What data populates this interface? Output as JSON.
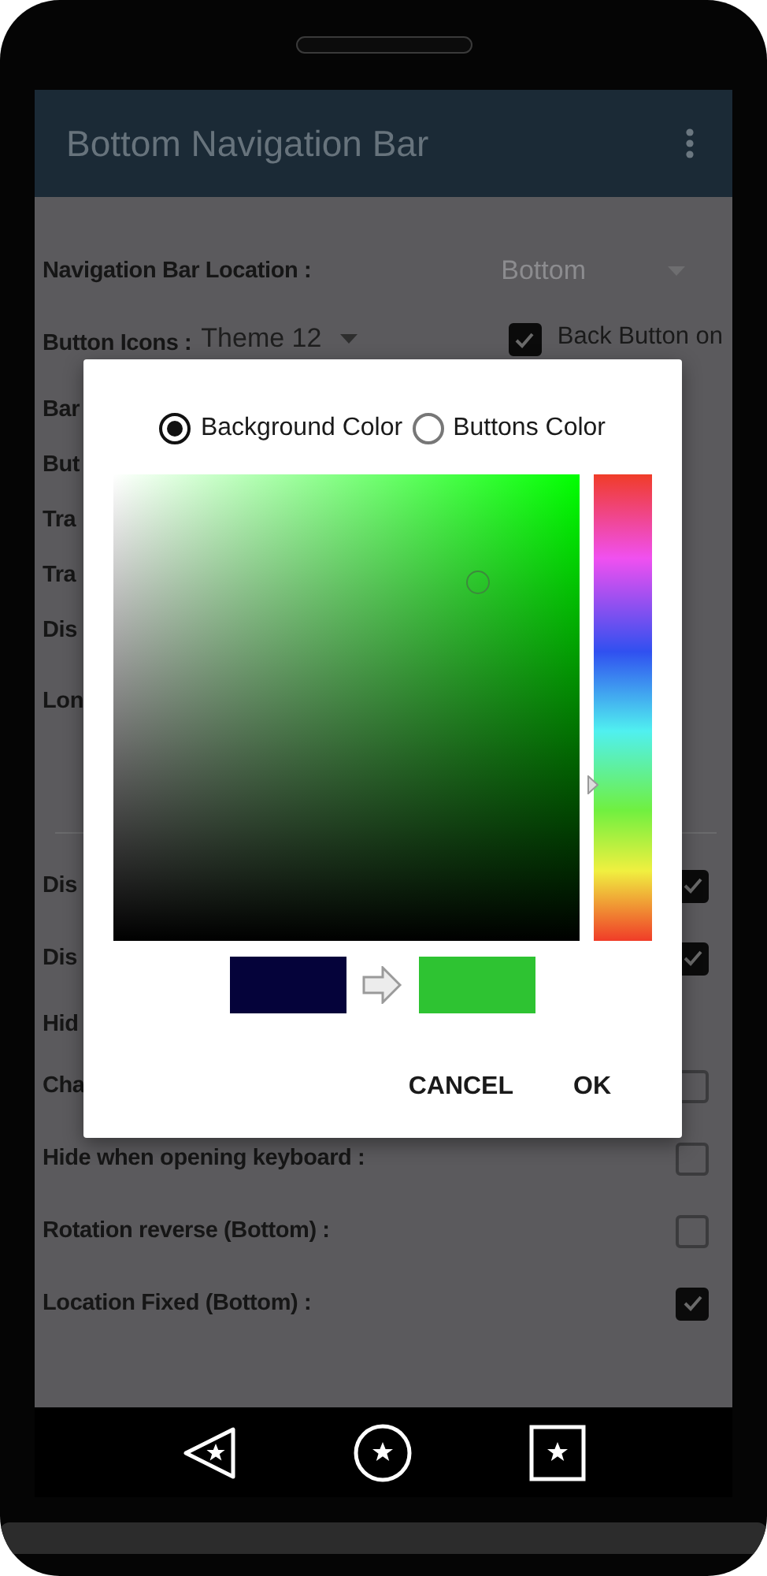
{
  "title": "Bottom Navigation Bar",
  "settings": [
    {
      "kind": "dropdown",
      "label": "Navigation Bar Location :",
      "value": "Bottom",
      "disabled": true
    },
    {
      "kind": "dropdown",
      "label": "Button Icons :",
      "value": "Theme 12",
      "disabled": false,
      "checkbox": {
        "label": "Back Button on",
        "checked": true
      }
    },
    {
      "kind": "label",
      "label": "Bar"
    },
    {
      "kind": "label",
      "label": "But"
    },
    {
      "kind": "label",
      "label": "Tra"
    },
    {
      "kind": "label",
      "label": "Tra"
    },
    {
      "kind": "label",
      "label": "Dis"
    },
    {
      "kind": "section",
      "label": "Lon"
    },
    {
      "kind": "checkbox",
      "label": "Dis",
      "checked": true
    },
    {
      "kind": "checkbox",
      "label": "Dis",
      "checked": true
    },
    {
      "kind": "label",
      "label": "Hid"
    },
    {
      "kind": "checkbox",
      "label": "Cha",
      "checked": false
    },
    {
      "kind": "checkbox",
      "label": "Hide when opening keyboard :",
      "checked": false
    },
    {
      "kind": "checkbox",
      "label": "Rotation reverse (Bottom) :",
      "checked": false
    },
    {
      "kind": "checkbox",
      "label": "Location Fixed (Bottom) :",
      "checked": true
    }
  ],
  "dialog": {
    "options": [
      {
        "label": "Background Color",
        "selected": true
      },
      {
        "label": "Buttons Color",
        "selected": false
      }
    ],
    "picker": {
      "saturation": {
        "level": 0.78
      },
      "brightness": {
        "level": 0.77
      }
    },
    "hue": {
      "level": 0.333
    },
    "swatches": [
      {
        "color": "#05033a"
      },
      {
        "color": "#2ec332"
      }
    ],
    "buttons": [
      "CANCEL",
      "OK"
    ]
  }
}
